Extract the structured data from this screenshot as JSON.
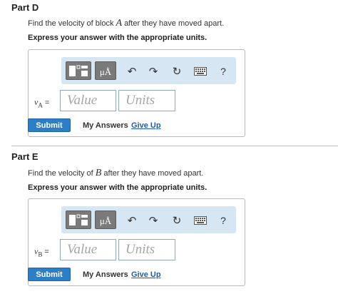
{
  "part_d": {
    "title": "Part D",
    "question_pre": "Find the velocity of block ",
    "question_var": "A",
    "question_post": " after they have moved apart.",
    "instruction": "Express your answer with the appropriate units.",
    "var_name": "v",
    "var_sub": "A",
    "eq": "=",
    "value_placeholder": "Value",
    "units_placeholder": "Units",
    "submit": "Submit",
    "my_answers": "My Answers",
    "give_up": "Give Up"
  },
  "part_e": {
    "title": "Part E",
    "question_pre": "Find the velocity of ",
    "question_var": "B",
    "question_post": " after they have moved apart.",
    "instruction": "Express your answer with the appropriate units.",
    "var_name": "v",
    "var_sub": "B",
    "eq": "=",
    "value_placeholder": "Value",
    "units_placeholder": "Units",
    "submit": "Submit",
    "my_answers": "My Answers",
    "give_up": "Give Up"
  },
  "toolbar": {
    "units_symbol": "μÅ",
    "undo": "↶",
    "redo": "↷",
    "reset": "↻",
    "help": "?",
    "icons": [
      "templates-icon",
      "units-icon",
      "undo-icon",
      "redo-icon",
      "reset-icon",
      "keyboard-icon",
      "help-icon"
    ]
  },
  "colors": {
    "toolbar_bg": "#d7e6f3",
    "submit_bg": "#2d7ec6",
    "link": "#1f5ea8"
  }
}
